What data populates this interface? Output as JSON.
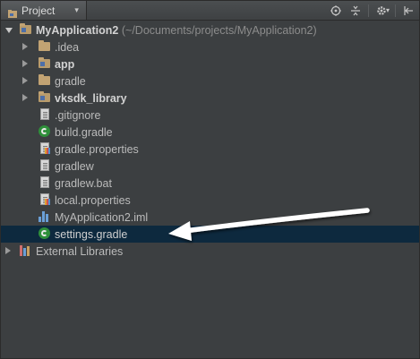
{
  "toolbar": {
    "view_label": "Project",
    "view_caret": "▾",
    "icons": [
      "target-icon",
      "collapse-all-icon",
      "gear-icon",
      "hide-panel-icon"
    ]
  },
  "tree": {
    "root": {
      "name": "MyApplication2",
      "path": "(~/Documents/projects/MyApplication2)"
    },
    "children": [
      {
        "name": ".idea",
        "kind": "folder",
        "expanded": false,
        "bold": false
      },
      {
        "name": "app",
        "kind": "module-folder",
        "expanded": false,
        "bold": true
      },
      {
        "name": "gradle",
        "kind": "folder",
        "expanded": false,
        "bold": false
      },
      {
        "name": "vksdk_library",
        "kind": "module-folder",
        "expanded": false,
        "bold": true
      },
      {
        "name": ".gitignore",
        "kind": "text-file"
      },
      {
        "name": "build.gradle",
        "kind": "gradle-file"
      },
      {
        "name": "gradle.properties",
        "kind": "properties-file"
      },
      {
        "name": "gradlew",
        "kind": "text-file"
      },
      {
        "name": "gradlew.bat",
        "kind": "text-file"
      },
      {
        "name": "local.properties",
        "kind": "properties-file"
      },
      {
        "name": "MyApplication2.iml",
        "kind": "iml-file"
      },
      {
        "name": "settings.gradle",
        "kind": "gradle-file",
        "selected": true
      }
    ],
    "external": {
      "name": "External Libraries",
      "expanded": false
    }
  },
  "colors": {
    "background": "#3c3f41",
    "selection": "#0d293e",
    "text": "#bbbbbb",
    "path_text": "#8c8c8c",
    "gradle_green": "#2e8f3a",
    "folder": "#c2a373",
    "annotation_arrow": "#ffffff"
  }
}
